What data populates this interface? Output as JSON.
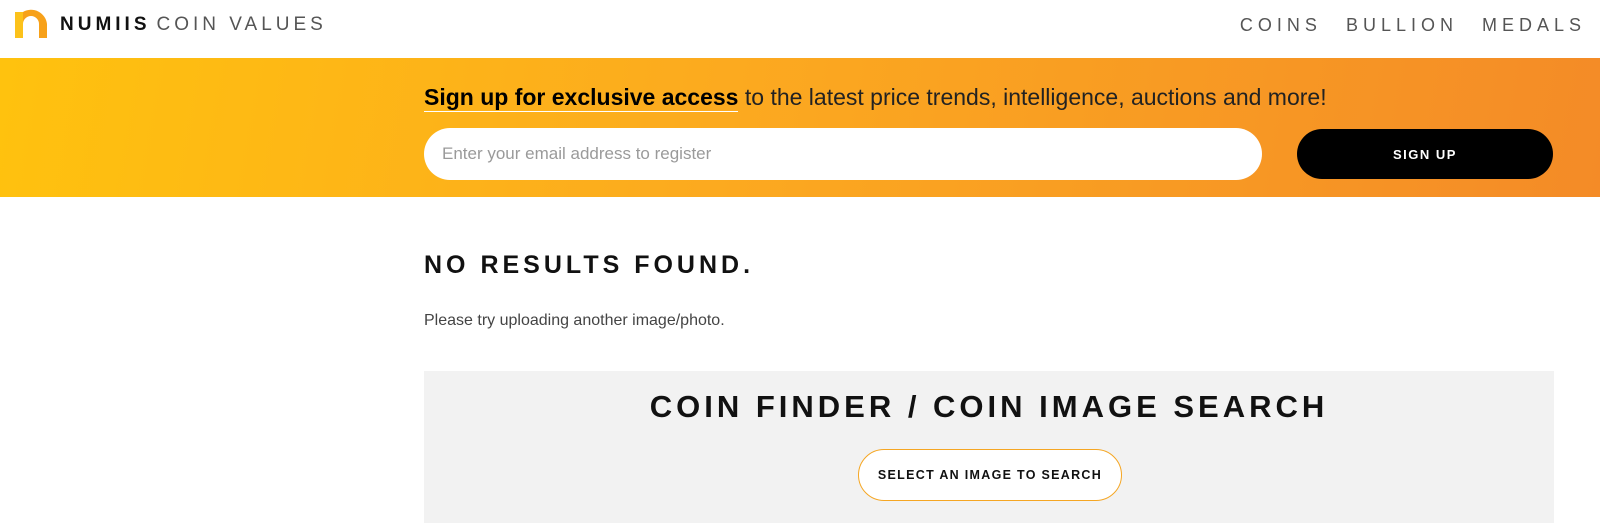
{
  "header": {
    "brand_bold": "NUMIIS",
    "brand_light": "COIN VALUES",
    "logo_icon": "numiis-logo-icon",
    "nav": [
      {
        "label": "COINS"
      },
      {
        "label": "BULLION"
      },
      {
        "label": "MEDALS"
      }
    ]
  },
  "banner": {
    "headline_strong": "Sign up for exclusive access",
    "headline_rest": " to the latest price trends, intelligence, auctions and more!",
    "email_placeholder": "Enter your email address to register",
    "signup_label": "SIGN UP",
    "gradient_colors": [
      "#ffc20e",
      "#fcaa1f",
      "#f48b27"
    ]
  },
  "results": {
    "heading": "NO RESULTS FOUND.",
    "message": "Please try uploading another image/photo."
  },
  "finder": {
    "title": "COIN FINDER / COIN IMAGE SEARCH",
    "select_label": "SELECT AN IMAGE TO SEARCH",
    "accent_color": "#f5a623"
  }
}
